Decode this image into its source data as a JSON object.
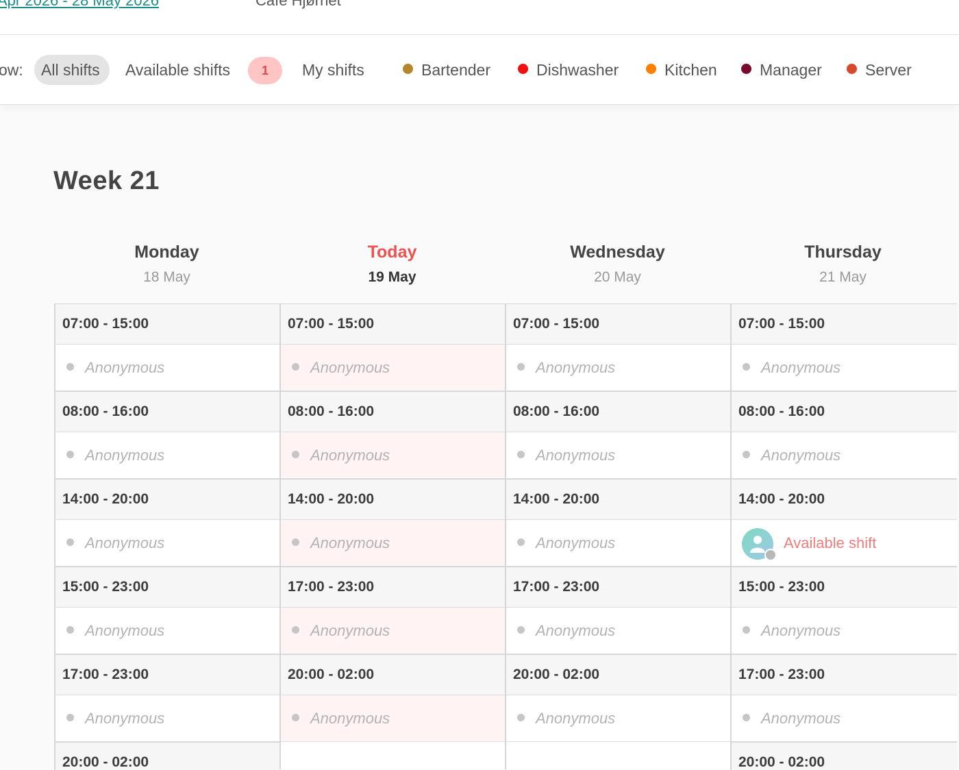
{
  "header": {
    "period_link": "Apr 2026 - 28 May 2026",
    "location": "Café Hjørnet"
  },
  "filters": {
    "show_label": "ow:",
    "all_shifts": "All shifts",
    "available_shifts": "Available shifts",
    "available_count": "1",
    "my_shifts": "My shifts",
    "active": "All shifts"
  },
  "legend": [
    {
      "label": "Bartender",
      "color": "#b5862a"
    },
    {
      "label": "Dishwasher",
      "color": "#f01010"
    },
    {
      "label": "Kitchen",
      "color": "#ff7f00"
    },
    {
      "label": "Manager",
      "color": "#7a0a2e"
    },
    {
      "label": "Server",
      "color": "#d9482b"
    }
  ],
  "week": {
    "title": "Week 21",
    "days": [
      {
        "name": "Monday",
        "date": "18 May",
        "today": false,
        "shifts": [
          {
            "time": "07:00 - 15:00",
            "person": "Anonymous"
          },
          {
            "time": "08:00 - 16:00",
            "person": "Anonymous"
          },
          {
            "time": "14:00 - 20:00",
            "person": "Anonymous"
          },
          {
            "time": "15:00 - 23:00",
            "person": "Anonymous"
          },
          {
            "time": "17:00 - 23:00",
            "person": "Anonymous"
          }
        ],
        "next_time": "20:00 - 02:00"
      },
      {
        "name": "Today",
        "date": "19 May",
        "today": true,
        "shifts": [
          {
            "time": "07:00 - 15:00",
            "person": "Anonymous"
          },
          {
            "time": "08:00 - 16:00",
            "person": "Anonymous"
          },
          {
            "time": "14:00 - 20:00",
            "person": "Anonymous"
          },
          {
            "time": "17:00 - 23:00",
            "person": "Anonymous"
          },
          {
            "time": "20:00 - 02:00",
            "person": "Anonymous"
          }
        ],
        "next_time": ""
      },
      {
        "name": "Wednesday",
        "date": "20 May",
        "today": false,
        "shifts": [
          {
            "time": "07:00 - 15:00",
            "person": "Anonymous"
          },
          {
            "time": "08:00 - 16:00",
            "person": "Anonymous"
          },
          {
            "time": "14:00 - 20:00",
            "person": "Anonymous"
          },
          {
            "time": "17:00 - 23:00",
            "person": "Anonymous"
          },
          {
            "time": "20:00 - 02:00",
            "person": "Anonymous"
          }
        ],
        "next_time": ""
      },
      {
        "name": "Thursday",
        "date": "21 May",
        "today": false,
        "shifts": [
          {
            "time": "07:00 - 15:00",
            "person": "Anonymous"
          },
          {
            "time": "08:00 - 16:00",
            "person": "Anonymous"
          },
          {
            "time": "14:00 - 20:00",
            "person": "Available shift",
            "available": true
          },
          {
            "time": "15:00 - 23:00",
            "person": "Anonymous"
          },
          {
            "time": "17:00 - 23:00",
            "person": "Anonymous"
          }
        ],
        "next_time": "20:00 - 02:00"
      }
    ]
  }
}
